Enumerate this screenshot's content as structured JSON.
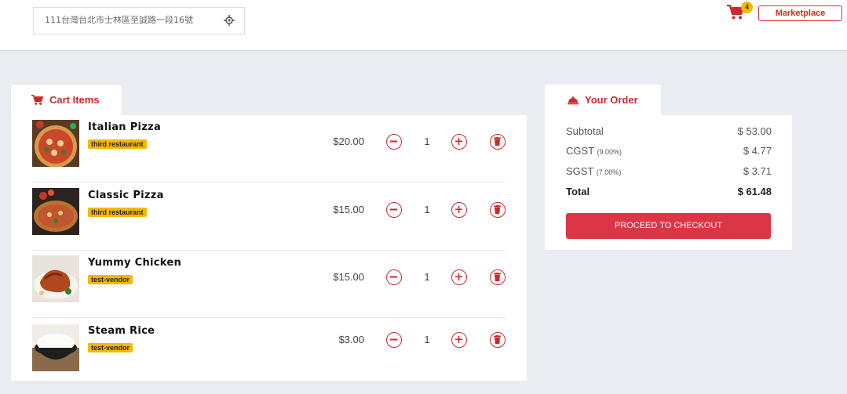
{
  "header": {
    "address_value": "111台灣台北市士林區至誠路一段16號",
    "cart_count": "4",
    "marketplace_label": "Marketplace"
  },
  "cart": {
    "tab_label": "Cart Items",
    "items": [
      {
        "name": "Italian Pizza",
        "vendor": "third restaurant",
        "price": "$20.00",
        "qty": "1",
        "image": "italian-pizza"
      },
      {
        "name": "Classic Pizza",
        "vendor": "third restaurant",
        "price": "$15.00",
        "qty": "1",
        "image": "classic-pizza"
      },
      {
        "name": "Yummy Chicken",
        "vendor": "test-vendor",
        "price": "$15.00",
        "qty": "1",
        "image": "grilled-chicken"
      },
      {
        "name": "Steam Rice",
        "vendor": "test-vendor",
        "price": "$3.00",
        "qty": "1",
        "image": "steamed-rice"
      }
    ]
  },
  "order": {
    "tab_label": "Your Order",
    "subtotal_label": "Subtotal",
    "subtotal_value": "$ 53.00",
    "cgst_label": "CGST",
    "cgst_rate": "(9.00%)",
    "cgst_value": "$ 4.77",
    "sgst_label": "SGST",
    "sgst_rate": "(7.00%)",
    "sgst_value": "$ 3.71",
    "total_label": "Total",
    "total_value": "$ 61.48",
    "checkout_label": "PROCEED TO CHECKOUT"
  },
  "colors": {
    "brand_red": "#cc2a2a",
    "badge_yellow": "#f5b800",
    "checkout_red": "#dc3545",
    "page_bg": "#ebecf1"
  }
}
